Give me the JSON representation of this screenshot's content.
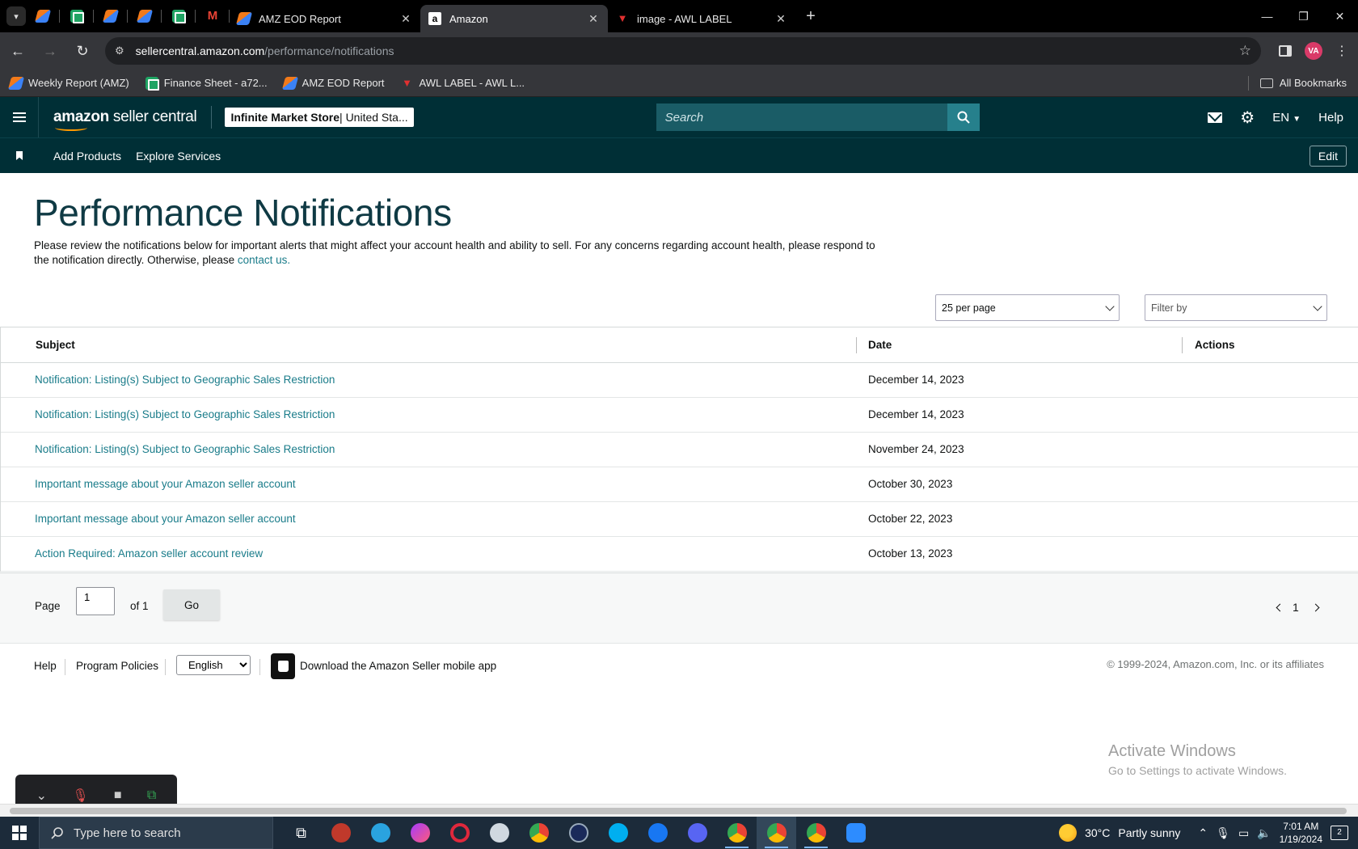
{
  "browser": {
    "tabs": [
      {
        "title": "AMZ EOD Report",
        "icon": "spark-icon"
      },
      {
        "title": "Amazon",
        "icon": "amazon-icon",
        "active": true
      },
      {
        "title": "image - AWL LABEL",
        "icon": "awl-icon"
      }
    ],
    "url_host": "sellercentral.amazon.com",
    "url_path": "/performance/notifications",
    "profile_initials": "VA",
    "bookmarks": [
      {
        "label": "Weekly Report (AMZ)"
      },
      {
        "label": "Finance Sheet - a72..."
      },
      {
        "label": "AMZ EOD Report"
      },
      {
        "label": "AWL LABEL - AWL L..."
      }
    ],
    "all_bookmarks": "All Bookmarks"
  },
  "header": {
    "logo_bold": "amazon",
    "logo_rest": " seller central",
    "store_name": "Infinite Market Store",
    "store_region": " | United Sta...",
    "search_placeholder": "Search",
    "language": "EN",
    "help": "Help"
  },
  "subnav": {
    "links": [
      "Add Products",
      "Explore Services"
    ],
    "edit": "Edit"
  },
  "page": {
    "title": "Performance Notifications",
    "intro_text": "Please review the notifications below for important alerts that might affect your account health and ability to sell. For any concerns regarding account health, please respond to the notification directly. Otherwise, please ",
    "intro_link": "contact us."
  },
  "controls": {
    "per_page": "25 per page",
    "filter": "Filter by"
  },
  "table": {
    "columns": [
      "Subject",
      "Date",
      "Actions"
    ],
    "rows": [
      {
        "subject": "Notification: Listing(s) Subject to Geographic Sales Restriction",
        "date": "December 14, 2023"
      },
      {
        "subject": "Notification: Listing(s) Subject to Geographic Sales Restriction",
        "date": "December 14, 2023"
      },
      {
        "subject": "Notification: Listing(s) Subject to Geographic Sales Restriction",
        "date": "November 24, 2023"
      },
      {
        "subject": "Important message about your Amazon seller account",
        "date": "October 30, 2023"
      },
      {
        "subject": "Important message about your Amazon seller account",
        "date": "October 22, 2023"
      },
      {
        "subject": "Action Required: Amazon seller account review",
        "date": "October 13, 2023"
      }
    ]
  },
  "pager": {
    "page_label": "Page",
    "page_value": "1",
    "of_label": "of 1",
    "go": "Go",
    "current": "1"
  },
  "footer": {
    "help": "Help",
    "policies": "Program Policies",
    "language_option": "English",
    "app_text": "Download the Amazon Seller mobile app",
    "copyright": "© 1999-2024, Amazon.com, Inc. or its affiliates"
  },
  "watermark": {
    "line1": "Activate Windows",
    "line2": "Go to Settings to activate Windows."
  },
  "taskbar": {
    "search_placeholder": "Type here to search",
    "temperature": "30°C",
    "weather": "Partly sunny",
    "time": "7:01 AM",
    "date": "1/19/2024",
    "notifications": "2"
  },
  "colors": {
    "header_bg": "#002f36",
    "link": "#1a7c8a",
    "title": "#0f3a44"
  }
}
